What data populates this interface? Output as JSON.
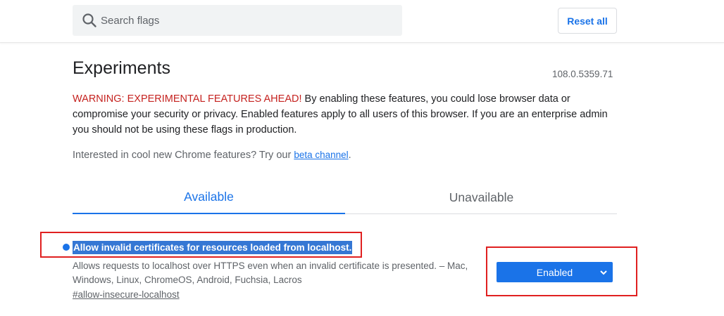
{
  "header": {
    "search_placeholder": "Search flags",
    "reset_label": "Reset all"
  },
  "main": {
    "title": "Experiments",
    "version": "108.0.5359.71",
    "warning_prefix": "WARNING: EXPERIMENTAL FEATURES AHEAD!",
    "warning_body": " By enabling these features, you could lose browser data or compromise your security or privacy. Enabled features apply to all users of this browser. If you are an enterprise admin you should not be using these flags in production.",
    "beta_text": "Interested in cool new Chrome features? Try our ",
    "beta_link": "beta channel",
    "beta_suffix": "."
  },
  "tabs": [
    {
      "label": "Available",
      "active": true
    },
    {
      "label": "Unavailable",
      "active": false
    }
  ],
  "experiment": {
    "title": "Allow invalid certificates for resources loaded from localhost.",
    "description": "Allows requests to localhost over HTTPS even when an invalid certificate is presented. – Mac, Windows, Linux, ChromeOS, Android, Fuchsia, Lacros",
    "link": "#allow-insecure-localhost",
    "state": "Enabled"
  },
  "colors": {
    "accent": "#1a73e8",
    "warning": "#c5221f",
    "highlight_box": "#e02020"
  }
}
